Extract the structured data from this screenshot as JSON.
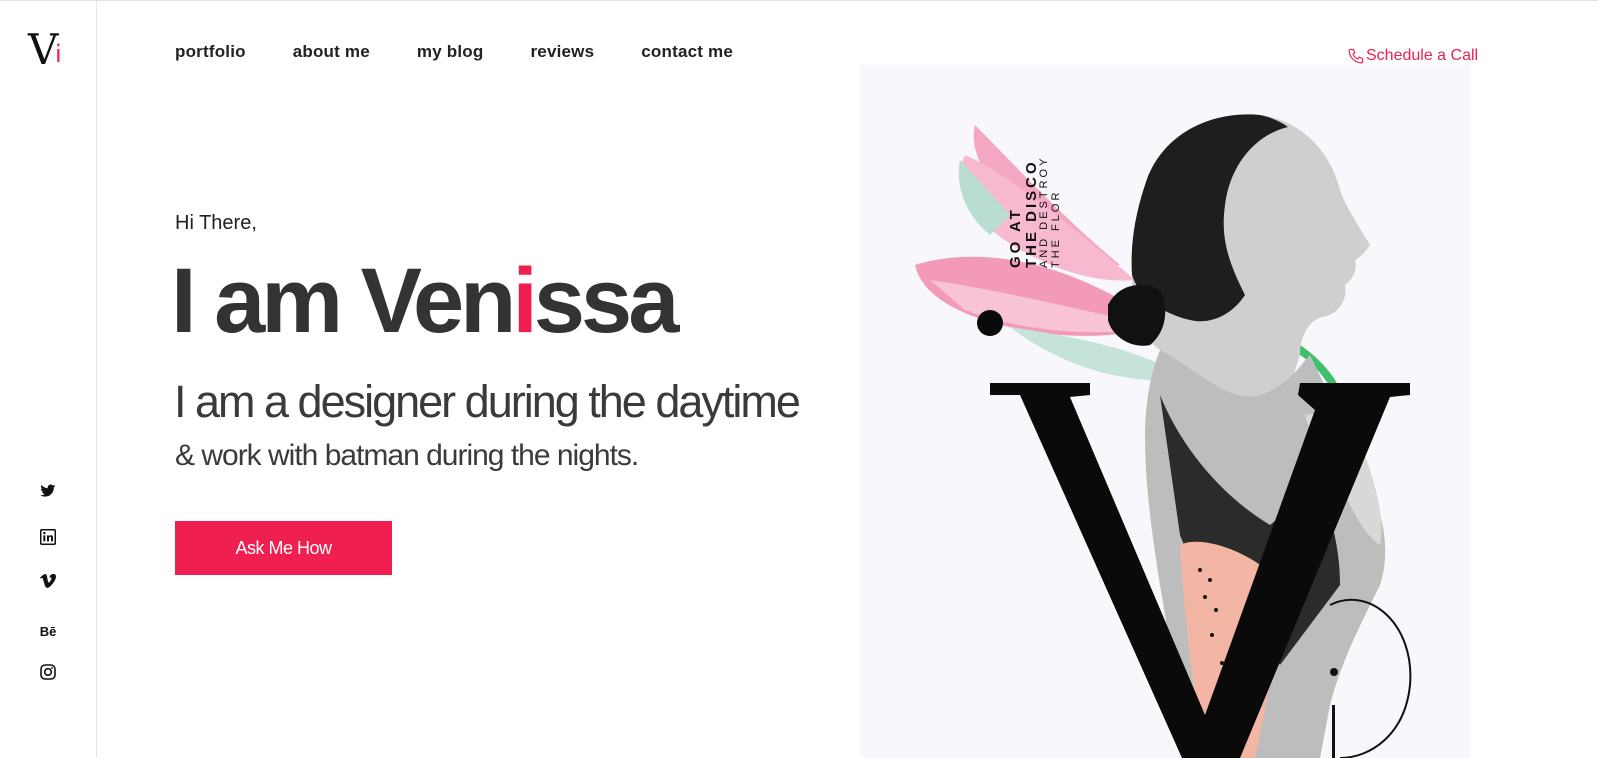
{
  "brand": {
    "logo_letter": "V",
    "logo_accent": "i"
  },
  "nav": {
    "items": [
      "portfolio",
      "about me",
      "my blog",
      "reviews",
      "contact me"
    ],
    "schedule_label": "Schedule a Call"
  },
  "hero": {
    "greeting": "Hi There,",
    "name_prefix": "I am Ven",
    "name_accent": "i",
    "name_suffix": "ssa",
    "tagline_1": "I am a designer during the daytime",
    "tagline_2": "& work with batman during the nights.",
    "cta_label": "Ask Me How"
  },
  "artwork": {
    "line_1": "GO AT",
    "line_2": "THE DISCO",
    "line_3": "AND DESTROY",
    "line_4": "THE FLOR"
  },
  "socials": {
    "behance_text": "Bē",
    "icons": [
      "twitter-icon",
      "linkedin-icon",
      "vimeo-icon",
      "behance-icon",
      "instagram-icon"
    ]
  },
  "colors": {
    "accent": "#ef1f4f",
    "text": "#333333",
    "panel": "#f8f7fb",
    "peach": "#f4b6a4",
    "lily_pink": "#f29ab8"
  }
}
